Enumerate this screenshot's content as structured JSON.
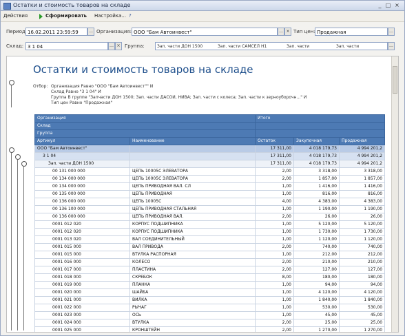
{
  "window": {
    "title": "Остатки и стоимость товаров на складе"
  },
  "toolbar": {
    "actions_label": "Действия",
    "generate_label": "Сформировать",
    "settings_label": "Настройка..."
  },
  "filters": {
    "period_label": "Период:",
    "period_value": "16.02.2011 23:59:59",
    "org_label": "Организация:",
    "org_value": "ООО \"Бам Автоинвест\"",
    "price_type_label": "Тип цен:",
    "price_type_value": "Продажная",
    "warehouse_label": "Склад:",
    "warehouse_value": "3 1 04",
    "group_label": "Группа:",
    "group_chips": [
      "Зап. части ДОН 1500",
      "Зап. части САМСЕЛ Н1",
      "Зап. части",
      "Зап. части"
    ]
  },
  "report": {
    "title": "Остатки и стоимость товаров на складе",
    "params": [
      {
        "label": "Отбор:",
        "value": "Организация Равно \"ООО \"Бам Автоинвест\"\" И"
      },
      {
        "label": "",
        "value": "Склад Равно \"3 1 04\" И"
      },
      {
        "label": "",
        "value": "Группа В группе \"Запчасти ДОН 1500; Зап. части ДАСОЙ, НИВА; Зап. части с колеса; Зап. части к зерноуборочн...\" И"
      },
      {
        "label": "",
        "value": "Тип цен Равно \"Продажная\""
      }
    ],
    "headers": {
      "org": "Организация",
      "warehouse": "Склад",
      "group": "Группа",
      "article": "Артикул",
      "name": "Наименование",
      "total": "Итого",
      "balance": "Остаток",
      "purchase": "Закупочная",
      "sale": "Продажная"
    },
    "rows": [
      {
        "level": 1,
        "article": "ООО \"Бам Автоинвест\"",
        "name": "",
        "balance": "17 311,00",
        "purchase": "4 018 179,73",
        "sale": "4 994 201,2"
      },
      {
        "level": 2,
        "article": "3 1 04",
        "name": "",
        "balance": "17 311,00",
        "purchase": "4 018 179,73",
        "sale": "4 994 201,2"
      },
      {
        "level": 3,
        "article": "Зап. части ДОН 1500",
        "name": "",
        "balance": "17 311,00",
        "purchase": "4 018 179,73",
        "sale": "4 994 201,2"
      },
      {
        "level": 0,
        "article": "00 131 000 000",
        "name": "ЦЕПЬ 10005С ЭЛЕВАТОРА",
        "balance": "2,00",
        "purchase": "3 318,00",
        "sale": "3 318,00"
      },
      {
        "level": 0,
        "article": "00 134 000 000",
        "name": "ЦЕПЬ 10005С ЭЛЕВАТОРА",
        "balance": "2,00",
        "purchase": "1 857,00",
        "sale": "1 857,00"
      },
      {
        "level": 0,
        "article": "00 134 000 000",
        "name": "ЦЕПЬ ПРИВОДНАЯ ВАЛ. СЛ",
        "balance": "1,00",
        "purchase": "1 416,00",
        "sale": "1 416,00"
      },
      {
        "level": 0,
        "article": "00 135 000 000",
        "name": "ЦЕПЬ ПРИВОДНАЯ",
        "balance": "1,00",
        "purchase": "816,00",
        "sale": "816,00"
      },
      {
        "level": 0,
        "article": "00 136 000 000",
        "name": "ЦЕПЬ 10005С",
        "balance": "4,00",
        "purchase": "4 383,00",
        "sale": "4 383,00"
      },
      {
        "level": 0,
        "article": "00 136 100 000",
        "name": "ЦЕПЬ ПРИВОДНАЯ СТАЛЬНАЯ",
        "balance": "1,00",
        "purchase": "1 190,00",
        "sale": "1 190,00"
      },
      {
        "level": 0,
        "article": "00 136 000 000",
        "name": "ЦЕПЬ ПРИВОДНАЯ ВАЛ.",
        "balance": "2,00",
        "purchase": "26,00",
        "sale": "26,00"
      },
      {
        "level": 0,
        "article": "0001 012 020",
        "name": "КОРПУС ПОДШИПНИКА",
        "balance": "1,00",
        "purchase": "5 120,00",
        "sale": "5 120,00"
      },
      {
        "level": 0,
        "article": "0001 012 020",
        "name": "КОРПУС ПОДШИПНИКА",
        "balance": "1,00",
        "purchase": "1 730,00",
        "sale": "1 730,00"
      },
      {
        "level": 0,
        "article": "0001 013 020",
        "name": "ВАЛ СОЕДИНИТЕЛЬНЫЙ",
        "balance": "1,00",
        "purchase": "1 120,00",
        "sale": "1 120,00"
      },
      {
        "level": 0,
        "article": "0001 015 000",
        "name": "ВАЛ ПРИВОДА",
        "balance": "2,00",
        "purchase": "740,00",
        "sale": "740,00"
      },
      {
        "level": 0,
        "article": "0001 015 000",
        "name": "ВТУЛКА РАСПОРНАЯ",
        "balance": "1,00",
        "purchase": "212,00",
        "sale": "212,00"
      },
      {
        "level": 0,
        "article": "0001 016 000",
        "name": "КОЛЕСО",
        "balance": "2,00",
        "purchase": "210,00",
        "sale": "210,00"
      },
      {
        "level": 0,
        "article": "0001 017 000",
        "name": "ПЛАСТИНА",
        "balance": "2,00",
        "purchase": "127,00",
        "sale": "127,00"
      },
      {
        "level": 0,
        "article": "0001 018 000",
        "name": "СКРЕБОК",
        "balance": "8,00",
        "purchase": "180,00",
        "sale": "180,00"
      },
      {
        "level": 0,
        "article": "0001 019 000",
        "name": "ПЛАНКА",
        "balance": "1,00",
        "purchase": "94,00",
        "sale": "94,00"
      },
      {
        "level": 0,
        "article": "0001 020 000",
        "name": "ШАЙБА",
        "balance": "1,00",
        "purchase": "4 120,00",
        "sale": "4 120,00"
      },
      {
        "level": 0,
        "article": "0001 021 000",
        "name": "ВИЛКА",
        "balance": "1,00",
        "purchase": "1 840,00",
        "sale": "1 840,00"
      },
      {
        "level": 0,
        "article": "0001 022 000",
        "name": "РЫЧАГ",
        "balance": "1,00",
        "purchase": "530,00",
        "sale": "530,00"
      },
      {
        "level": 0,
        "article": "0001 023 000",
        "name": "ОСЬ",
        "balance": "1,00",
        "purchase": "45,00",
        "sale": "45,00"
      },
      {
        "level": 0,
        "article": "0001 024 000",
        "name": "ВТУЛКА",
        "balance": "2,00",
        "purchase": "25,00",
        "sale": "25,00"
      },
      {
        "level": 0,
        "article": "0001 025 000",
        "name": "КРОНШТЕЙН",
        "balance": "2,00",
        "purchase": "1 270,00",
        "sale": "1 270,00"
      }
    ]
  }
}
